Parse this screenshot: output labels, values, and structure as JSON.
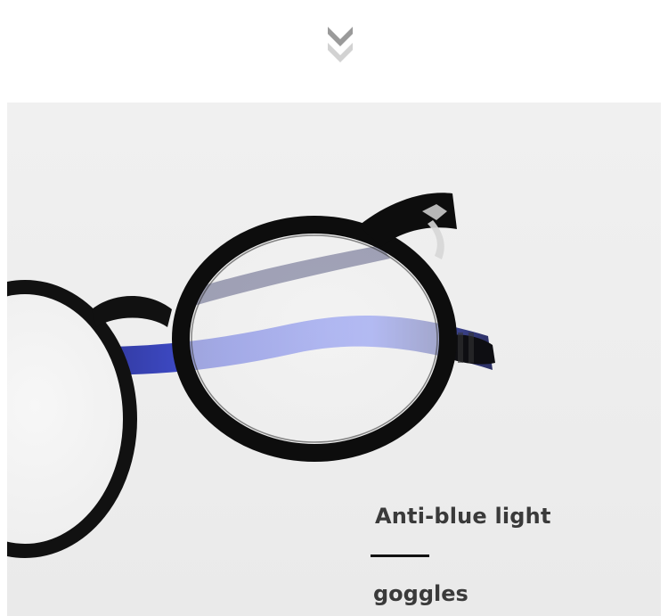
{
  "caption": {
    "title": "Anti-blue light",
    "subtitle": "goggles"
  },
  "icons": {
    "scroll_indicator": "double-chevron-down-icon"
  },
  "colors": {
    "background": "#ffffff",
    "photo_background": "#eeeeee",
    "frame": "#111111",
    "lens_reflection": "#2f3fd6",
    "caption_text": "#3a3a3a",
    "caption_rule": "#111111"
  }
}
